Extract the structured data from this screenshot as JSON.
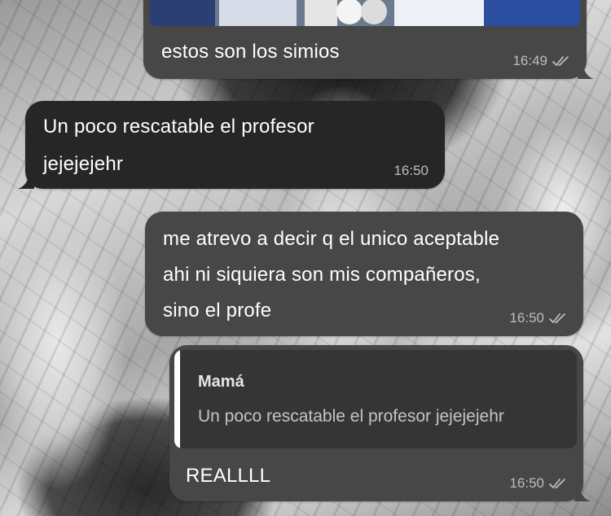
{
  "messages": [
    {
      "id": "m1",
      "direction": "out",
      "has_photo": true,
      "text": "estos son los simios",
      "time": "16:49",
      "status": "read"
    },
    {
      "id": "m2",
      "direction": "in",
      "lines": [
        "Un poco rescatable el profesor",
        "jejejejehr"
      ],
      "time": "16:50"
    },
    {
      "id": "m3",
      "direction": "out",
      "lines": [
        "me atrevo a decir q el unico aceptable",
        "ahi ni siquiera son mis compañeros,",
        "sino el profe"
      ],
      "time": "16:50",
      "status": "read"
    },
    {
      "id": "m4",
      "direction": "out",
      "reply_to": {
        "author": "Mamá",
        "snippet": "Un poco rescatable el profesor jejejejehr"
      },
      "text": "REALLLL",
      "time": "16:50",
      "status": "read"
    }
  ],
  "icons": {
    "read_receipt": "double-check-icon"
  },
  "colors": {
    "incoming_bubble": "#262626",
    "outgoing_bubble": "#474747",
    "reply_card": "#353535",
    "reply_bar": "#ffffff",
    "meta_text": "#bdbdbd"
  }
}
